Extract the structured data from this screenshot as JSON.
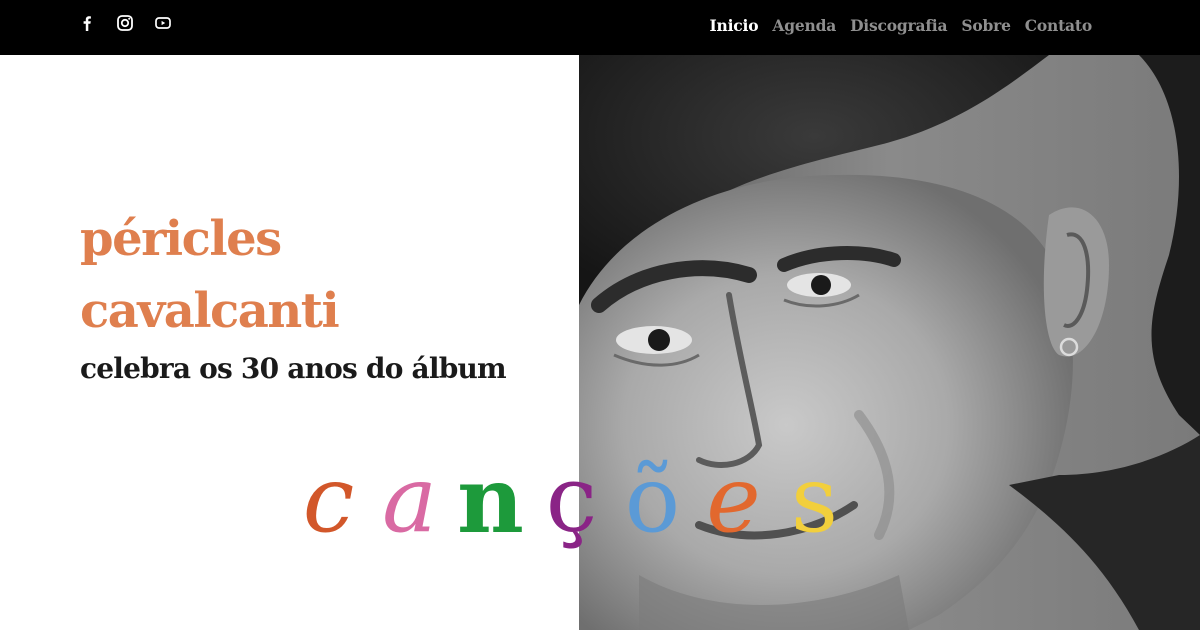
{
  "social": [
    {
      "name": "facebook-icon"
    },
    {
      "name": "instagram-icon"
    },
    {
      "name": "youtube-icon"
    }
  ],
  "nav": {
    "items": [
      {
        "label": "Inicio",
        "active": true
      },
      {
        "label": "Agenda",
        "active": false
      },
      {
        "label": "Discografia",
        "active": false
      },
      {
        "label": "Sobre",
        "active": false
      },
      {
        "label": "Contato",
        "active": false
      }
    ]
  },
  "hero": {
    "artist_line1": "péricles",
    "artist_line2": "cavalcanti",
    "subtitle": "celebra os 30 anos do álbum",
    "album_letters": [
      {
        "char": "c",
        "color": "#d2572a"
      },
      {
        "char": "a",
        "color": "#d96aa3"
      },
      {
        "char": "n",
        "color": "#1d9a3b"
      },
      {
        "char": "ç",
        "color": "#8a2486"
      },
      {
        "char": "õ",
        "color": "#5b9ad6"
      },
      {
        "char": "e",
        "color": "#e2682e"
      },
      {
        "char": "s",
        "color": "#f2cf3c"
      }
    ]
  },
  "colors": {
    "accent": "#df7f4e",
    "topbar": "#000000",
    "nav_active": "#ffffff",
    "nav_inactive": "#8f8f8f"
  }
}
